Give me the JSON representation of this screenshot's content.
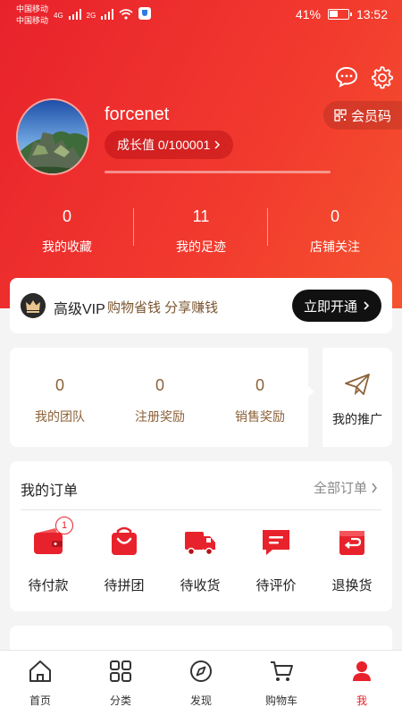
{
  "status_bar": {
    "carrier_1": "中国移动",
    "carrier_2": "中国移动",
    "net_1": "4G",
    "net_2": "2G",
    "battery": "41%",
    "time": "13:52"
  },
  "header": {
    "member_code_label": "会员码"
  },
  "profile": {
    "username": "forcenet",
    "growth_label": "成长值 0/100001",
    "growth_progress": 0
  },
  "stats": [
    {
      "value": "0",
      "label": "我的收藏"
    },
    {
      "value": "11",
      "label": "我的足迹"
    },
    {
      "value": "0",
      "label": "店铺关注"
    }
  ],
  "vip": {
    "title": "高级VIP",
    "slogan": "购物省钱 分享赚钱",
    "button": "立即开通"
  },
  "team": {
    "items": [
      {
        "value": "0",
        "label": "我的团队"
      },
      {
        "value": "0",
        "label": "注册奖励"
      },
      {
        "value": "0",
        "label": "销售奖励"
      }
    ],
    "promo_label": "我的推广"
  },
  "orders": {
    "title": "我的订单",
    "all_label": "全部订单",
    "items": [
      {
        "label": "待付款",
        "icon": "wallet-icon",
        "badge": "1"
      },
      {
        "label": "待拼团",
        "icon": "shopping-bag-icon"
      },
      {
        "label": "待收货",
        "icon": "truck-icon"
      },
      {
        "label": "待评价",
        "icon": "comment-icon"
      },
      {
        "label": "退换货",
        "icon": "return-icon"
      }
    ]
  },
  "tabbar": {
    "items": [
      {
        "label": "首页",
        "icon": "home-icon"
      },
      {
        "label": "分类",
        "icon": "grid-icon"
      },
      {
        "label": "发现",
        "icon": "compass-icon"
      },
      {
        "label": "购物车",
        "icon": "cart-icon"
      },
      {
        "label": "我",
        "icon": "user-icon",
        "active": true
      }
    ]
  },
  "colors": {
    "brand_red": "#e8222c",
    "gold_text": "#8c6238",
    "vip_button": "#111111"
  }
}
